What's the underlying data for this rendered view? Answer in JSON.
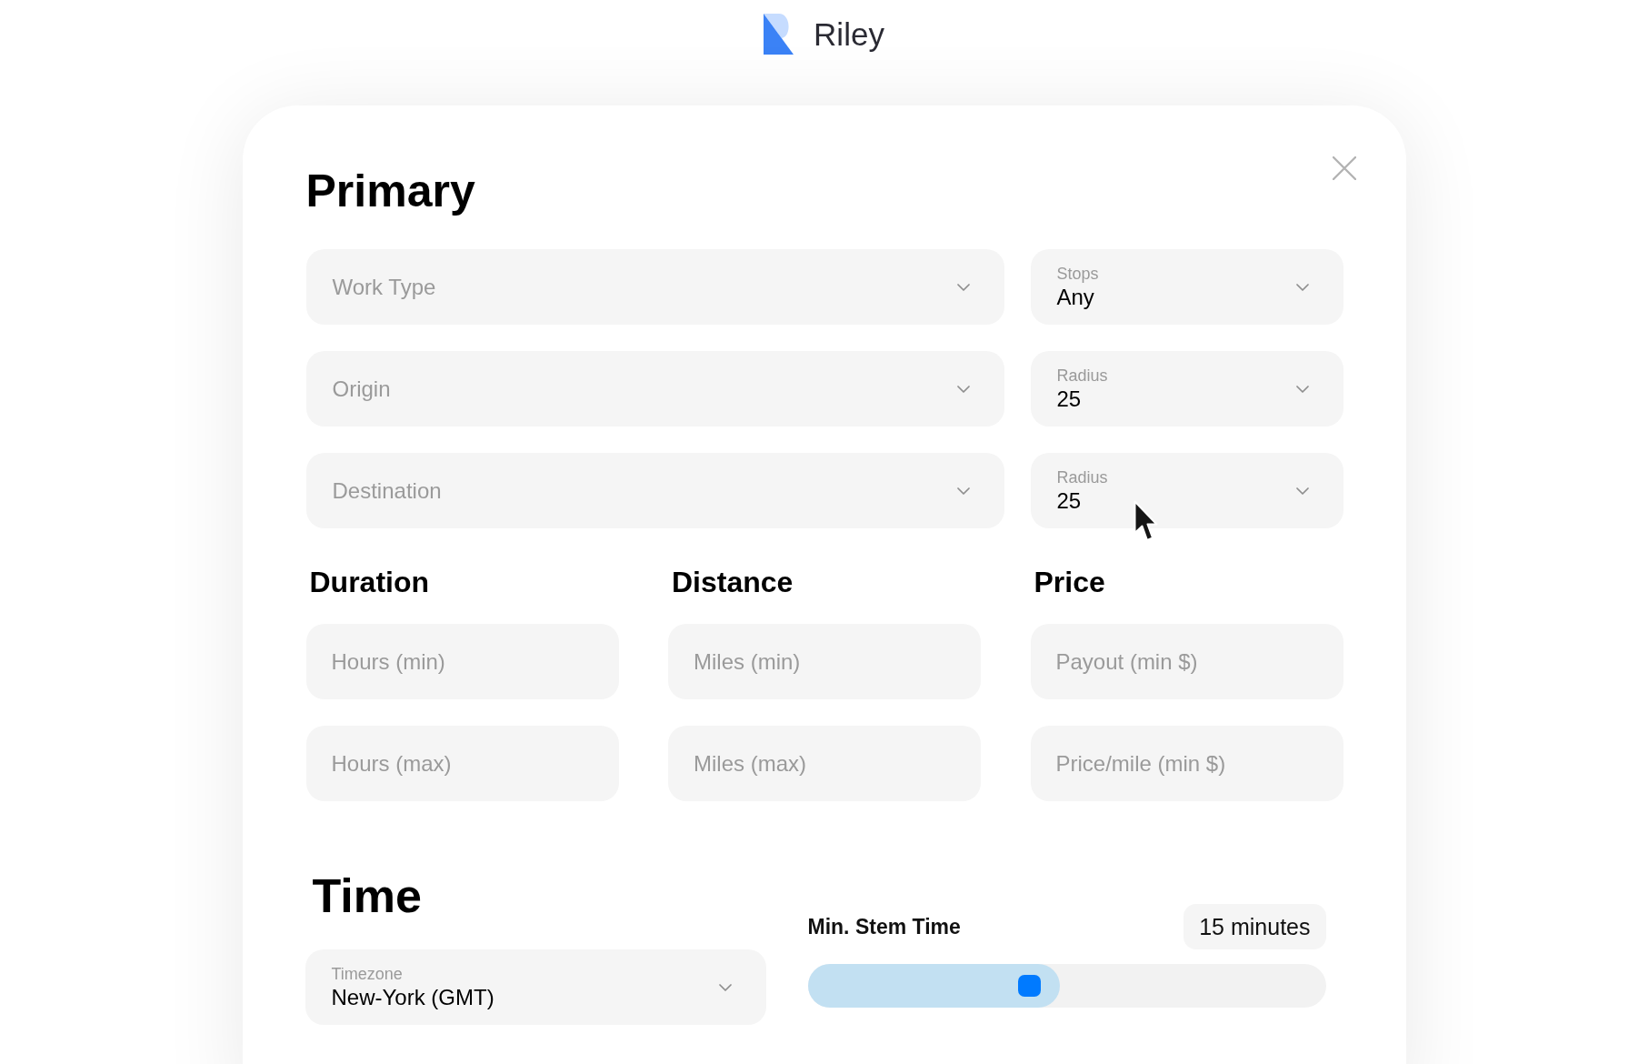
{
  "header": {
    "brand": "Riley"
  },
  "primary": {
    "title": "Primary",
    "rows": [
      {
        "main": {
          "placeholder": "Work Type"
        },
        "side": {
          "label": "Stops",
          "value": "Any"
        }
      },
      {
        "main": {
          "placeholder": "Origin"
        },
        "side": {
          "label": "Radius",
          "value": "25"
        }
      },
      {
        "main": {
          "placeholder": "Destination"
        },
        "side": {
          "label": "Radius",
          "value": "25"
        }
      }
    ]
  },
  "filters": [
    {
      "title": "Duration",
      "fields": [
        {
          "placeholder": "Hours (min)"
        },
        {
          "placeholder": "Hours (max)"
        }
      ]
    },
    {
      "title": "Distance",
      "fields": [
        {
          "placeholder": "Miles (min)"
        },
        {
          "placeholder": "Miles (max)"
        }
      ]
    },
    {
      "title": "Price",
      "fields": [
        {
          "placeholder": "Payout (min $)"
        },
        {
          "placeholder": "Price/mile (min $)"
        }
      ]
    }
  ],
  "time": {
    "title": "Time",
    "timezone": {
      "label": "Timezone",
      "value": "New-York (GMT)"
    },
    "min_stem_time": {
      "label": "Min. Stem Time",
      "reading": "15 minutes",
      "level": 0.486
    }
  }
}
